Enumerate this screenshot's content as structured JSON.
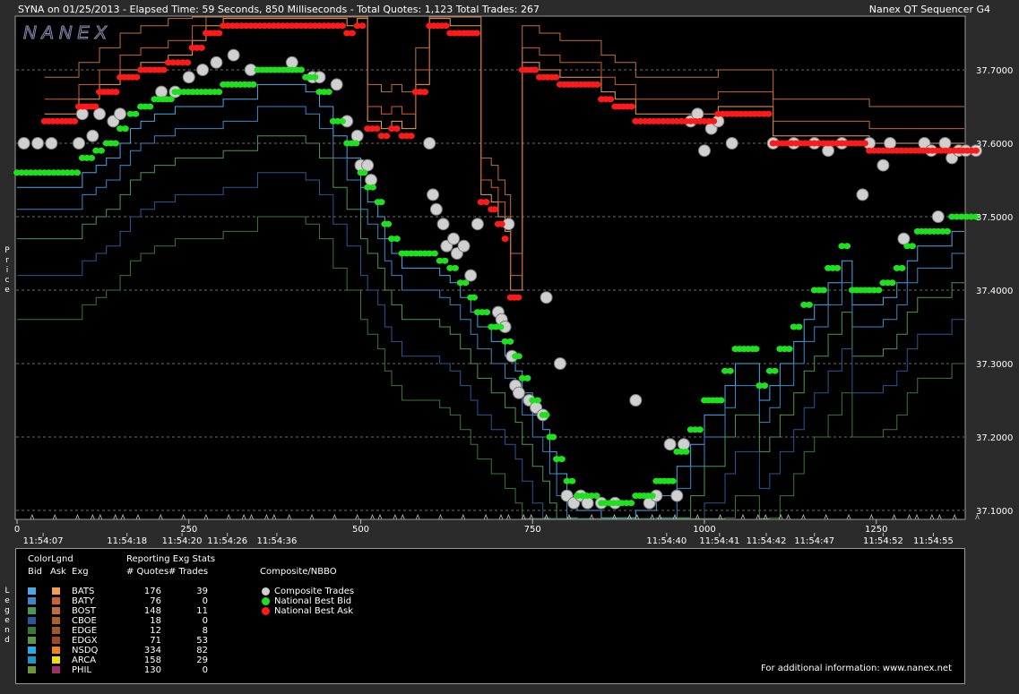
{
  "header": {
    "left_text": "SYNA on 01/25/2013  -  Elapsed Time: 59 Seconds, 850 Milliseconds  -  Total Quotes: 1,123  Total Trades: 267",
    "right_text": "Nanex QT Sequencer G4",
    "watermark": "NANEX"
  },
  "side_labels": {
    "price": "Price",
    "legend": "Legend"
  },
  "colors": {
    "background": "#000000",
    "page": "#2b2b2b",
    "grid": "#666666",
    "bid_marker": "#1fe01f",
    "ask_marker": "#ff1a1a",
    "trade_marker": "#d0d0d0"
  },
  "chart_data": {
    "type": "scatter",
    "title": "SYNA on 01/25/2013",
    "xlim": [
      0,
      1410
    ],
    "ylim": [
      37.09,
      37.8
    ],
    "grid": true,
    "y_ticks": [
      37.1,
      37.2,
      37.3,
      37.4,
      37.5,
      37.6,
      37.7
    ],
    "y_tick_labels": [
      "37.1000",
      "37.2000",
      "37.3000",
      "37.4000",
      "37.5000",
      "37.6000",
      "37.7000"
    ],
    "x_ticks": [
      0,
      250,
      500,
      750,
      1000,
      1250
    ],
    "x_tick_labels": [
      "0",
      "250",
      "500",
      "750",
      "1000",
      "1250"
    ],
    "time_labels": [
      {
        "x": 38,
        "label": "11:54:07"
      },
      {
        "x": 160,
        "label": "11:54:18"
      },
      {
        "x": 240,
        "label": "11:54:20"
      },
      {
        "x": 306,
        "label": "11:54:26"
      },
      {
        "x": 378,
        "label": "11:54:36"
      },
      {
        "x": 945,
        "label": "11:54:40"
      },
      {
        "x": 1022,
        "label": "11:54:41"
      },
      {
        "x": 1090,
        "label": "11:54:42"
      },
      {
        "x": 1160,
        "label": "11:54:47"
      },
      {
        "x": 1260,
        "label": "11:54:52"
      },
      {
        "x": 1333,
        "label": "11:54:55"
      }
    ],
    "series": [
      {
        "name": "National Best Bid",
        "color": "#1fe01f",
        "points": [
          [
            0,
            37.56
          ],
          [
            80,
            37.56
          ],
          [
            95,
            37.58
          ],
          [
            115,
            37.59
          ],
          [
            130,
            37.6
          ],
          [
            150,
            37.62
          ],
          [
            165,
            37.64
          ],
          [
            180,
            37.65
          ],
          [
            200,
            37.66
          ],
          [
            230,
            37.67
          ],
          [
            300,
            37.68
          ],
          [
            350,
            37.7
          ],
          [
            400,
            37.7
          ],
          [
            420,
            37.69
          ],
          [
            440,
            37.67
          ],
          [
            460,
            37.63
          ],
          [
            480,
            37.6
          ],
          [
            500,
            37.56
          ],
          [
            510,
            37.54
          ],
          [
            525,
            37.52
          ],
          [
            535,
            37.49
          ],
          [
            545,
            37.47
          ],
          [
            560,
            37.45
          ],
          [
            600,
            37.45
          ],
          [
            615,
            37.44
          ],
          [
            630,
            37.43
          ],
          [
            645,
            37.41
          ],
          [
            660,
            37.39
          ],
          [
            670,
            37.37
          ],
          [
            690,
            37.35
          ],
          [
            710,
            37.33
          ],
          [
            725,
            37.31
          ],
          [
            735,
            37.28
          ],
          [
            750,
            37.25
          ],
          [
            765,
            37.23
          ],
          [
            775,
            37.2
          ],
          [
            785,
            37.17
          ],
          [
            800,
            37.14
          ],
          [
            815,
            37.12
          ],
          [
            850,
            37.11
          ],
          [
            880,
            37.11
          ],
          [
            900,
            37.12
          ],
          [
            930,
            37.14
          ],
          [
            960,
            37.18
          ],
          [
            980,
            37.21
          ],
          [
            1000,
            37.25
          ],
          [
            1030,
            37.29
          ],
          [
            1045,
            37.32
          ],
          [
            1070,
            37.32
          ],
          [
            1080,
            37.27
          ],
          [
            1095,
            37.29
          ],
          [
            1110,
            37.32
          ],
          [
            1130,
            37.35
          ],
          [
            1145,
            37.38
          ],
          [
            1160,
            37.4
          ],
          [
            1180,
            37.43
          ],
          [
            1200,
            37.46
          ],
          [
            1215,
            37.4
          ],
          [
            1240,
            37.4
          ],
          [
            1260,
            37.41
          ],
          [
            1280,
            37.43
          ],
          [
            1295,
            37.46
          ],
          [
            1310,
            37.48
          ],
          [
            1340,
            37.48
          ],
          [
            1360,
            37.5
          ],
          [
            1395,
            37.5
          ]
        ]
      },
      {
        "name": "National Best Ask",
        "color": "#ff1a1a",
        "points": [
          [
            40,
            37.63
          ],
          [
            90,
            37.65
          ],
          [
            120,
            37.67
          ],
          [
            150,
            37.69
          ],
          [
            180,
            37.7
          ],
          [
            220,
            37.71
          ],
          [
            255,
            37.73
          ],
          [
            275,
            37.75
          ],
          [
            300,
            37.76
          ],
          [
            360,
            37.76
          ],
          [
            400,
            37.76
          ],
          [
            460,
            37.76
          ],
          [
            480,
            37.75
          ],
          [
            495,
            37.76
          ],
          [
            510,
            37.62
          ],
          [
            530,
            37.61
          ],
          [
            545,
            37.62
          ],
          [
            560,
            37.61
          ],
          [
            580,
            37.67
          ],
          [
            600,
            37.76
          ],
          [
            630,
            37.75
          ],
          [
            650,
            37.75
          ],
          [
            675,
            37.52
          ],
          [
            690,
            37.51
          ],
          [
            700,
            37.49
          ],
          [
            710,
            37.47
          ],
          [
            718,
            37.39
          ],
          [
            735,
            37.7
          ],
          [
            760,
            37.69
          ],
          [
            790,
            37.68
          ],
          [
            820,
            37.68
          ],
          [
            850,
            37.66
          ],
          [
            870,
            37.65
          ],
          [
            900,
            37.63
          ],
          [
            920,
            37.63
          ],
          [
            960,
            37.63
          ],
          [
            1020,
            37.64
          ],
          [
            1100,
            37.6
          ],
          [
            1200,
            37.6
          ],
          [
            1240,
            37.59
          ],
          [
            1300,
            37.59
          ],
          [
            1395,
            37.59
          ]
        ]
      },
      {
        "name": "Composite Trades",
        "color": "#d0d0d0",
        "points": [
          [
            10,
            37.6
          ],
          [
            30,
            37.6
          ],
          [
            50,
            37.6
          ],
          [
            90,
            37.6
          ],
          [
            95,
            37.64
          ],
          [
            110,
            37.61
          ],
          [
            120,
            37.64
          ],
          [
            140,
            37.63
          ],
          [
            150,
            37.64
          ],
          [
            210,
            37.67
          ],
          [
            230,
            37.67
          ],
          [
            250,
            37.69
          ],
          [
            270,
            37.7
          ],
          [
            290,
            37.71
          ],
          [
            315,
            37.72
          ],
          [
            340,
            37.7
          ],
          [
            400,
            37.71
          ],
          [
            430,
            37.69
          ],
          [
            440,
            37.69
          ],
          [
            465,
            37.68
          ],
          [
            480,
            37.63
          ],
          [
            495,
            37.61
          ],
          [
            500,
            37.57
          ],
          [
            515,
            37.55
          ],
          [
            510,
            37.57
          ],
          [
            600,
            37.6
          ],
          [
            605,
            37.53
          ],
          [
            610,
            37.51
          ],
          [
            620,
            37.49
          ],
          [
            625,
            37.46
          ],
          [
            635,
            37.47
          ],
          [
            640,
            37.45
          ],
          [
            650,
            37.46
          ],
          [
            660,
            37.42
          ],
          [
            670,
            37.49
          ],
          [
            700,
            37.37
          ],
          [
            705,
            37.36
          ],
          [
            710,
            37.35
          ],
          [
            715,
            37.49
          ],
          [
            720,
            37.31
          ],
          [
            725,
            37.27
          ],
          [
            730,
            37.26
          ],
          [
            745,
            37.25
          ],
          [
            755,
            37.24
          ],
          [
            765,
            37.23
          ],
          [
            770,
            37.39
          ],
          [
            790,
            37.3
          ],
          [
            800,
            37.12
          ],
          [
            810,
            37.11
          ],
          [
            820,
            37.12
          ],
          [
            830,
            37.11
          ],
          [
            850,
            37.11
          ],
          [
            870,
            37.11
          ],
          [
            900,
            37.25
          ],
          [
            920,
            37.11
          ],
          [
            930,
            37.12
          ],
          [
            950,
            37.19
          ],
          [
            960,
            37.12
          ],
          [
            970,
            37.19
          ],
          [
            980,
            37.63
          ],
          [
            990,
            37.64
          ],
          [
            1000,
            37.59
          ],
          [
            1010,
            37.62
          ],
          [
            1020,
            37.63
          ],
          [
            1040,
            37.6
          ],
          [
            1100,
            37.6
          ],
          [
            1130,
            37.6
          ],
          [
            1160,
            37.6
          ],
          [
            1180,
            37.59
          ],
          [
            1200,
            37.6
          ],
          [
            1230,
            37.53
          ],
          [
            1240,
            37.6
          ],
          [
            1260,
            37.57
          ],
          [
            1270,
            37.6
          ],
          [
            1290,
            37.47
          ],
          [
            1320,
            37.6
          ],
          [
            1330,
            37.59
          ],
          [
            1340,
            37.5
          ],
          [
            1350,
            37.6
          ],
          [
            1360,
            37.58
          ],
          [
            1370,
            37.59
          ],
          [
            1380,
            37.59
          ],
          [
            1395,
            37.59
          ]
        ]
      }
    ]
  },
  "legend": {
    "colorlgnd_label": "ColorLgnd",
    "bid_header": "Bid",
    "ask_header": "Ask",
    "exg_header": "Exg",
    "stats_header": "Reporting Exg Stats",
    "quotes_header": "# Quotes",
    "trades_header": "# Trades",
    "composite_header": "Composite/NBBO",
    "rows": [
      {
        "exg": "BATS",
        "quotes": "176",
        "trades": "39",
        "bid": "#4aa8e8",
        "ask": "#f0a050"
      },
      {
        "exg": "BATY",
        "quotes": "76",
        "trades": "0",
        "bid": "#3a88c8",
        "ask": "#d06030"
      },
      {
        "exg": "BOST",
        "quotes": "148",
        "trades": "11",
        "bid": "#4a9858",
        "ask": "#c07040"
      },
      {
        "exg": "CBOE",
        "quotes": "18",
        "trades": "0",
        "bid": "#2a5898",
        "ask": "#b06020"
      },
      {
        "exg": "EDGE",
        "quotes": "12",
        "trades": "8",
        "bid": "#3a7838",
        "ask": "#a05830"
      },
      {
        "exg": "EDGX",
        "quotes": "71",
        "trades": "53",
        "bid": "#5a9848",
        "ask": "#a04820"
      },
      {
        "exg": "NSDQ",
        "quotes": "334",
        "trades": "82",
        "bid": "#2aa8e8",
        "ask": "#f08020"
      },
      {
        "exg": "ARCA",
        "quotes": "158",
        "trades": "29",
        "bid": "#1a98c8",
        "ask": "#f0e000"
      },
      {
        "exg": "PHIL",
        "quotes": "130",
        "trades": "0",
        "bid": "#6a9838",
        "ask": "#a03060"
      }
    ],
    "composite_items": [
      {
        "label": "Composite Trades",
        "color": "#d0d0d0"
      },
      {
        "label": "National Best Bid",
        "color": "#1fe01f"
      },
      {
        "label": "National Best Ask",
        "color": "#ff1a1a"
      }
    ],
    "footer": "For additional information: www.nanex.net"
  }
}
